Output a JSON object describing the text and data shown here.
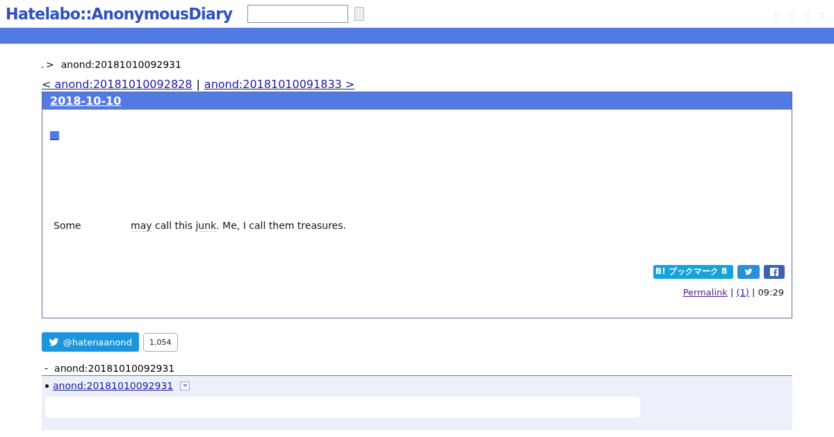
{
  "header": {
    "logo": "Hatelabo::AnonymousDiary"
  },
  "breadcrumb": {
    "separator": ">",
    "current": "anond:20181010092931"
  },
  "pager": {
    "prev": "< anond:20181010092828",
    "divider": "|",
    "next": "anond:20181010091833 >"
  },
  "day": {
    "date": "2018-10-10",
    "body": {
      "lead": "Some",
      "parts": [
        {
          "kind": "link",
          "text": "may"
        },
        {
          "kind": "text",
          "text": " call this "
        },
        {
          "kind": "link",
          "text": "junk"
        },
        {
          "kind": "text",
          "text": ". Me, I call them treasures."
        }
      ]
    },
    "bookmark": "B! ブックマーク 8",
    "footer": [
      {
        "kind": "link",
        "text": "Permalink",
        "visited": true
      },
      {
        "kind": "text",
        "text": " | "
      },
      {
        "kind": "link",
        "text": "(1)",
        "visited": false
      },
      {
        "kind": "text",
        "text": " | 09:29"
      }
    ]
  },
  "twitter": {
    "handle": "@hatenaanond",
    "count": "1,054"
  },
  "refs": {
    "heading_mark": "-",
    "heading": "anond:20181010092931",
    "items": [
      {
        "link": "anond:20181010092931"
      }
    ]
  }
}
